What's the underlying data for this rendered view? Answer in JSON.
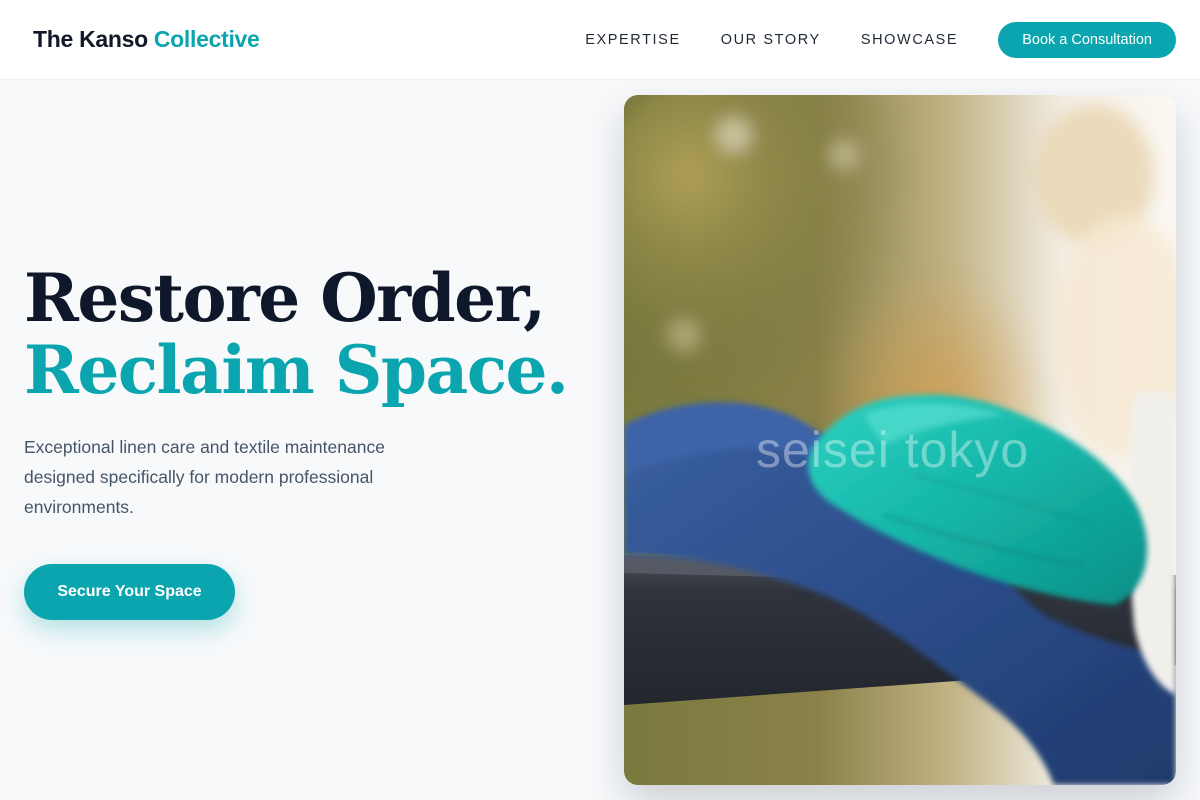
{
  "header": {
    "brand_primary": "The Kanso",
    "brand_accent": "Collective",
    "nav": [
      {
        "label": "EXPERTISE"
      },
      {
        "label": "OUR STORY"
      },
      {
        "label": "SHOWCASE"
      }
    ],
    "cta_label": "Book a Consultation"
  },
  "hero": {
    "headline_line1": "Restore Order,",
    "headline_line2": "Reclaim Space.",
    "subtext": "Exceptional linen care and textile maintenance designed specifically for modern professional environments.",
    "cta_label": "Secure Your Space",
    "image_watermark": "seisei tokyo"
  },
  "colors": {
    "accent": "#0aa5ae",
    "text_dark": "#0f172a",
    "text_muted": "#475569",
    "background": "#f7f9fb"
  }
}
